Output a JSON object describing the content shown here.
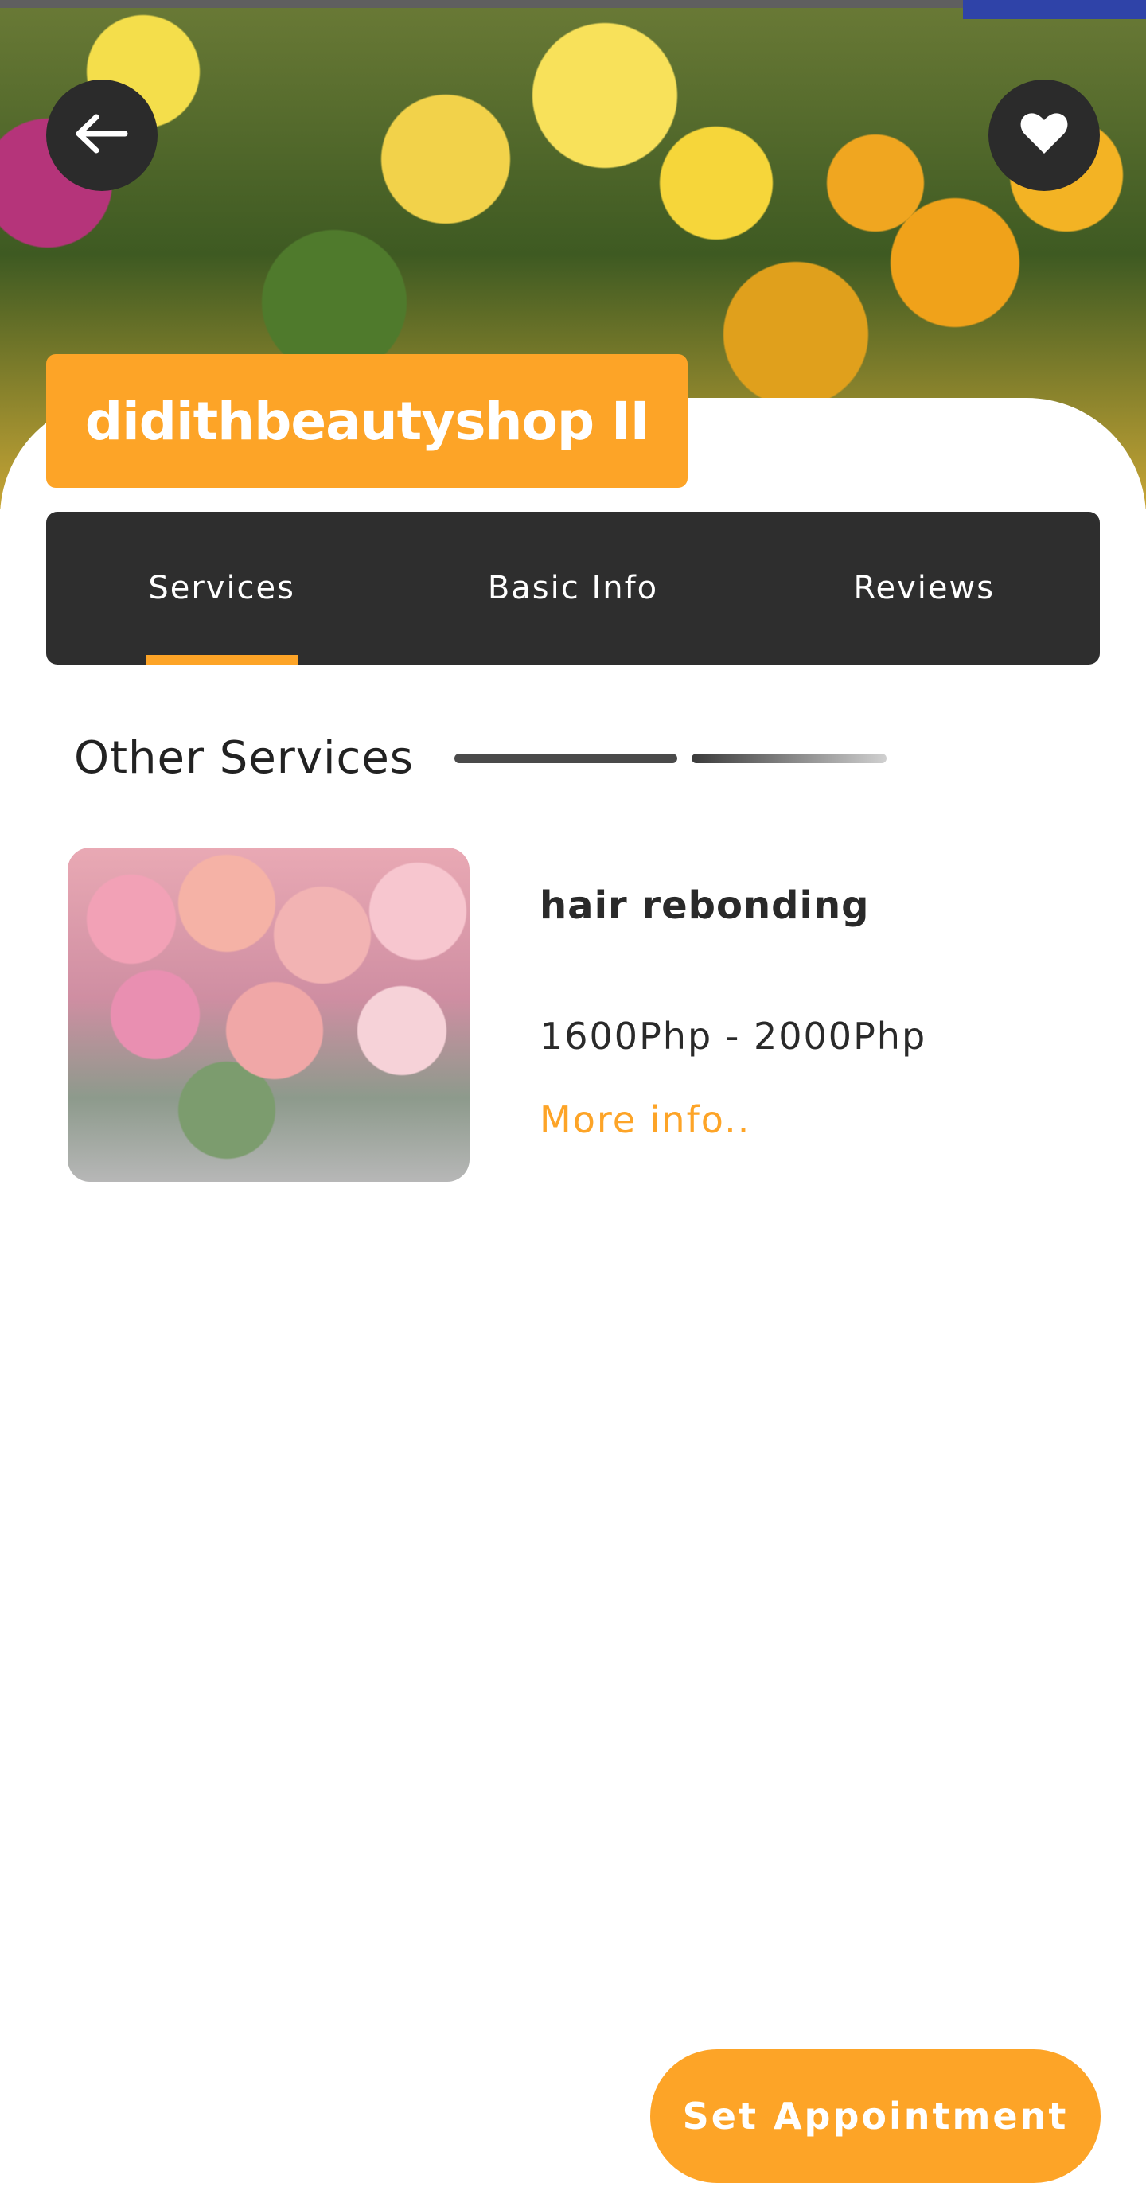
{
  "header": {
    "back_icon": "arrow-left-icon",
    "favorite_icon": "heart-icon"
  },
  "shop": {
    "name": "didithbeautyshop II"
  },
  "tabs": [
    {
      "label": "Services",
      "active": true
    },
    {
      "label": "Basic Info",
      "active": false
    },
    {
      "label": "Reviews",
      "active": false
    }
  ],
  "section": {
    "title": "Other Services"
  },
  "services": [
    {
      "name": "hair rebonding",
      "price": "1600Php - 2000Php",
      "more_label": "More info.."
    }
  ],
  "actions": {
    "appointment_label": "Set Appointment"
  },
  "colors": {
    "accent": "#fda427",
    "dark": "#2e2e2e"
  }
}
